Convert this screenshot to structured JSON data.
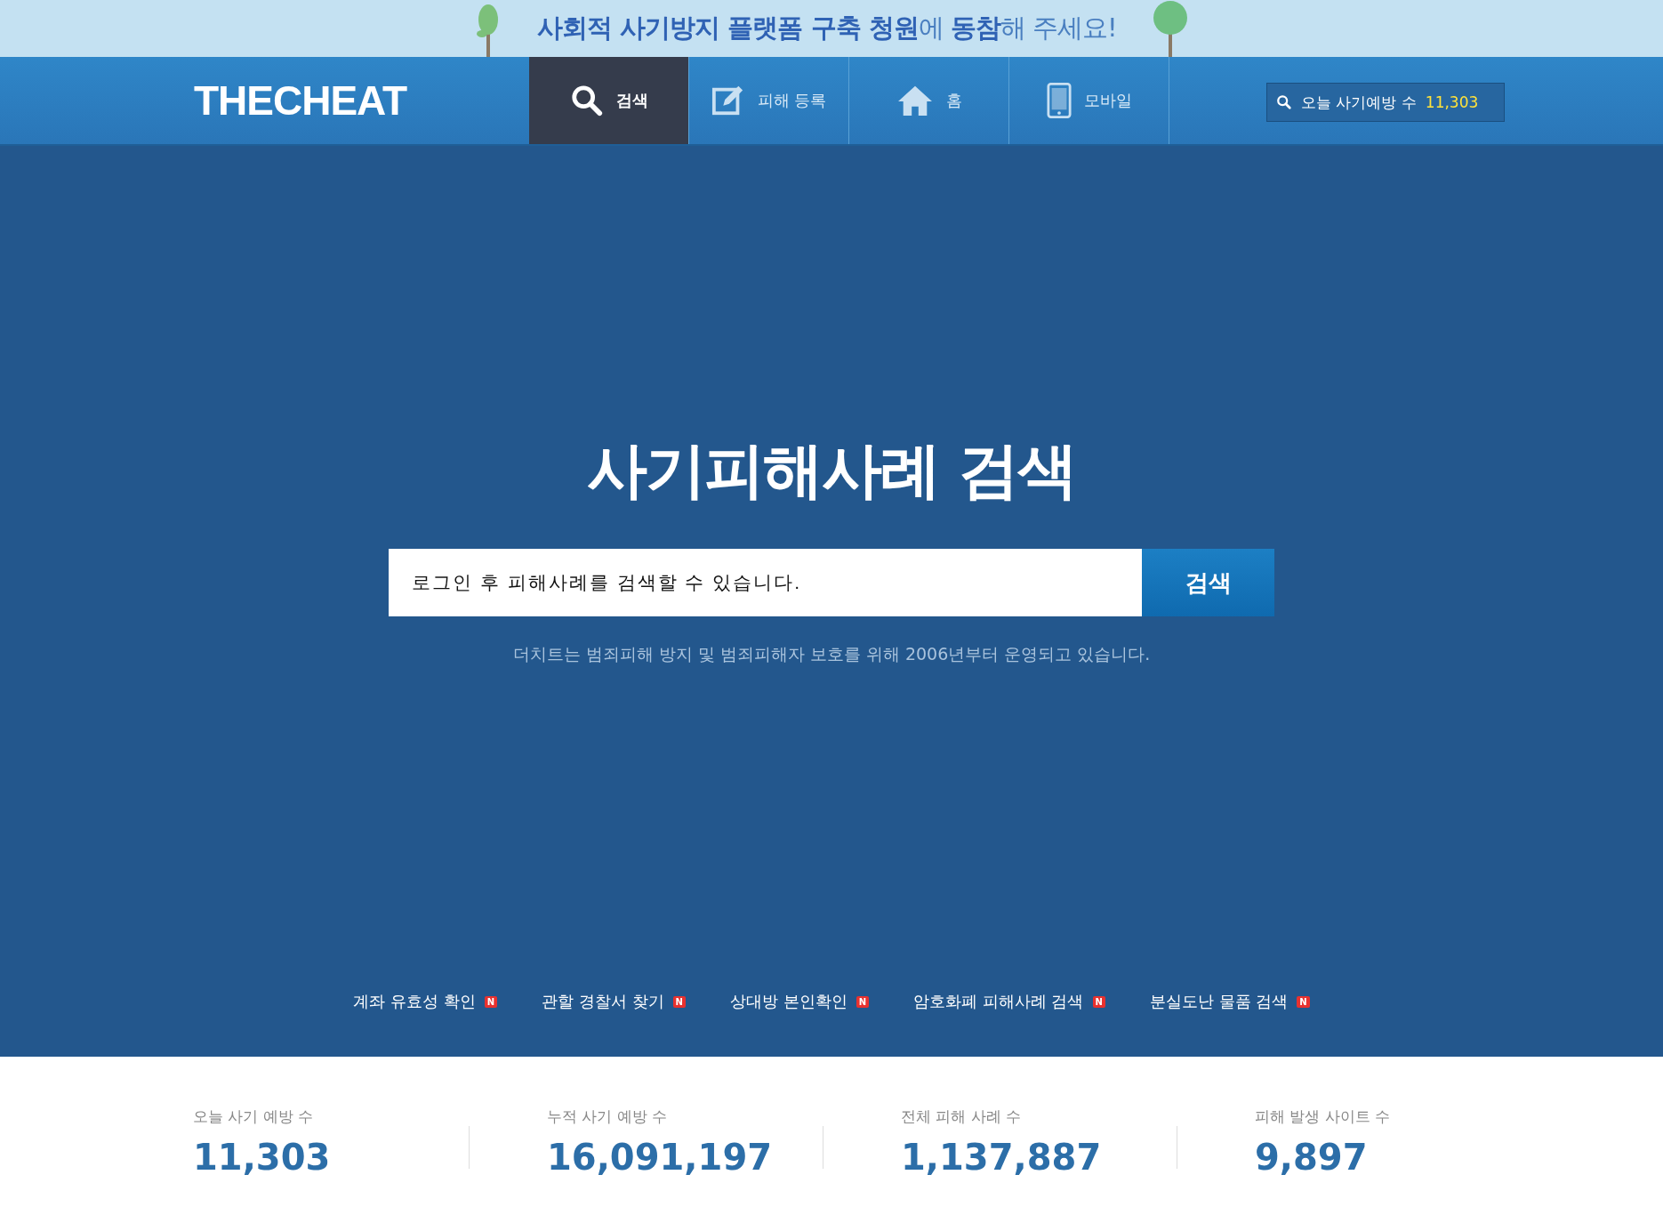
{
  "banner": {
    "text": "**사회적 사기방지 플랫폼 구축 청원**에 **동참**해 주세요!"
  },
  "header": {
    "logo": "THECHEAT",
    "nav": [
      {
        "kind": "search",
        "label": "검색",
        "selected": true
      },
      {
        "kind": "edit",
        "label": "피해 등록",
        "selected": false
      },
      {
        "kind": "home",
        "label": "홈",
        "selected": false
      },
      {
        "kind": "mobile",
        "label": "모바일",
        "selected": false
      }
    ],
    "counter": {
      "label": "오늘 사기예방 수",
      "value": "11,303"
    }
  },
  "hero": {
    "title": "사기피해사례 검색",
    "search": {
      "placeholder": "로그인 후 피해사례를 검색할 수 있습니다.",
      "button": "검색"
    },
    "note": "더치트는 범죄피해 방지 및 범죄피해자 보호를 위해 2006년부터 운영되고 있습니다."
  },
  "quick_links": [
    {
      "label": "계좌 유효성 확인",
      "badge": "N"
    },
    {
      "label": "관할 경찰서 찾기",
      "badge": "N"
    },
    {
      "label": "상대방 본인확인",
      "badge": "N"
    },
    {
      "label": "암호화폐 피해사례 검색",
      "badge": "N"
    },
    {
      "label": "분실도난 물품 검색",
      "badge": "N"
    }
  ],
  "stats": [
    {
      "label": "오늘 사기 예방 수",
      "value": "11,303"
    },
    {
      "label": "누적 사기 예방 수",
      "value": "16,091,197"
    },
    {
      "label": "전체 피해 사례 수",
      "value": "1,137,887"
    },
    {
      "label": "피해 발생 사이트 수",
      "value": "9,897"
    }
  ]
}
